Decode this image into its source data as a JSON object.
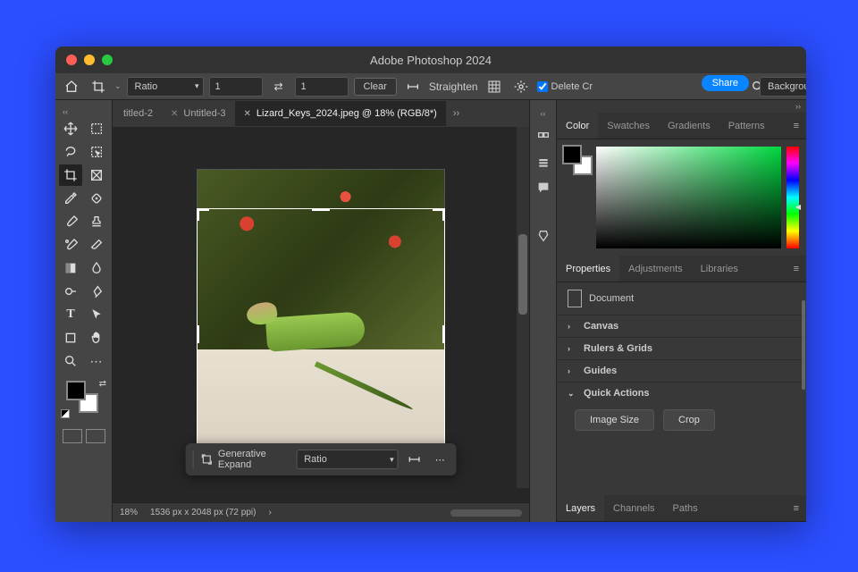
{
  "title": "Adobe Photoshop 2024",
  "share_label": "Share",
  "optbar": {
    "ratio_preset": "Ratio",
    "w": "1",
    "h": "1",
    "clear": "Clear",
    "straighten": "Straighten",
    "delete_cropped": "Delete Cr",
    "overlay_label": "Background"
  },
  "tabs": [
    {
      "label": "titled-2"
    },
    {
      "label": "Untitled-3"
    },
    {
      "label": "Lizard_Keys_2024.jpeg @ 18% (RGB/8*)"
    }
  ],
  "context": {
    "gen_expand": "Generative Expand",
    "ratio": "Ratio"
  },
  "status": {
    "zoom": "18%",
    "dims": "1536 px x 2048 px (72 ppi)"
  },
  "color_tabs": [
    "Color",
    "Swatches",
    "Gradients",
    "Patterns"
  ],
  "props_tabs": [
    "Properties",
    "Adjustments",
    "Libraries"
  ],
  "props": {
    "doc_label": "Document",
    "canvas": "Canvas",
    "rulers": "Rulers & Grids",
    "guides": "Guides",
    "quick_actions": "Quick Actions",
    "image_size": "Image Size",
    "crop": "Crop"
  },
  "bottom_tabs": [
    "Layers",
    "Channels",
    "Paths"
  ]
}
